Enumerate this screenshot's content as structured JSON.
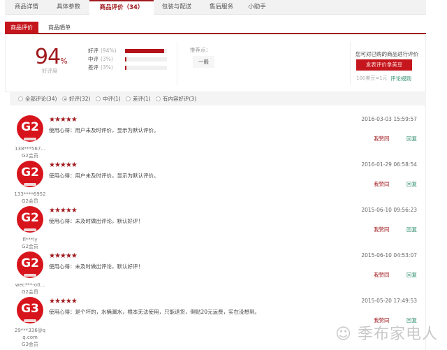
{
  "tabs": [
    "商品详情",
    "具体参数",
    "商品评价（34）",
    "包装与配送",
    "售后服务",
    "小助手"
  ],
  "subtabs": [
    "商品评价",
    "商品晒单"
  ],
  "summary": {
    "good_rate": "94",
    "pct_sign": "%",
    "good_rate_label": "好评度",
    "ratings": [
      {
        "label": "好评",
        "pct": "(94%)",
        "value": 94
      },
      {
        "label": "中评",
        "pct": "(3%)",
        "value": 3
      },
      {
        "label": "差评",
        "pct": "(3%)",
        "value": 3
      }
    ],
    "recommend_label": "推荐点：",
    "tag": "一般",
    "cta_text": "您可对已购的商品进行评价",
    "cta_button": "发表评价拿美豆",
    "beans_note": "100美豆=1元",
    "rules_link": "评论规则"
  },
  "filters": [
    {
      "label": "全部评论(34)",
      "checked": false
    },
    {
      "label": "好评(32)",
      "checked": true
    },
    {
      "label": "中评(1)",
      "checked": false
    },
    {
      "label": "差评(1)",
      "checked": false
    },
    {
      "label": "有内容好评(3)",
      "checked": false
    }
  ],
  "reviews": [
    {
      "avatar": "G2",
      "user": "138***567...",
      "level": "G2会员",
      "stars": "★★★★★",
      "text": "使用心得：用户未及时评价，显示为默认评价。",
      "date": "2016-03-03 15:59:57",
      "agree": "我赞同",
      "reply": "回复"
    },
    {
      "avatar": "G2",
      "user": "133****6952",
      "level": "G2会员",
      "stars": "★★★★★",
      "text": "使用心得：用户未及时评价，显示为默认评价。",
      "date": "2016-01-29 06:58:54",
      "agree": "我赞同",
      "reply": "回复"
    },
    {
      "avatar": "G2",
      "user": "fl***ly",
      "level": "G2会员",
      "stars": "★★★★★",
      "text": "使用心得：未及时做出评论，默认好评！",
      "date": "2015-06-10 09:56:23",
      "agree": "我赞同",
      "reply": "回复"
    },
    {
      "avatar": "G2",
      "user": "wec***-o0...",
      "level": "G2会员",
      "stars": "★★★★★",
      "text": "使用心得：未及时做出评论，默认好评！",
      "date": "2015-06-10 04:53:07",
      "agree": "我赞同",
      "reply": "回复"
    },
    {
      "avatar": "G3",
      "user": "29***336@q q.com",
      "level": "G3会员",
      "stars": "★★★★★",
      "text": "使用心得：是个坏的，水桶漏水，根本无法使用，只能退货，倒贴20元运费，实在没想到。",
      "date": "2015-05-20 17:49:53",
      "agree": "我赞同",
      "reply": "回复"
    }
  ],
  "watermark": "季布家电人"
}
